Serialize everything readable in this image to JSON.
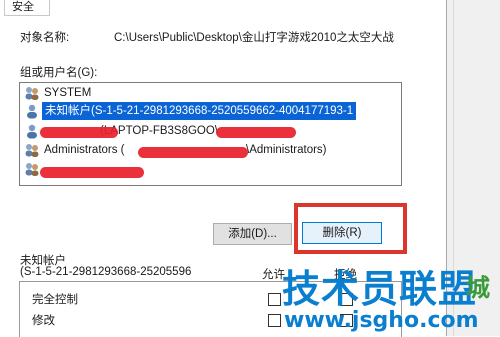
{
  "tab": {
    "label": "安全"
  },
  "object": {
    "label": "对象名称:",
    "value": "C:\\Users\\Public\\Desktop\\金山打字游戏2010之太空大战"
  },
  "groups": {
    "label": "组或用户名(G):",
    "items": [
      {
        "label": "SYSTEM",
        "selected": false
      },
      {
        "label": "未知帐户(S-1-5-21-2981293668-2520559662-4004177193-1",
        "selected": true
      },
      {
        "label": "(LAPTOP-FB3S8GOO\\",
        "selected": false
      },
      {
        "label": "Administrators (",
        "suffix": "\\Administrators)",
        "selected": false
      },
      {
        "label": "",
        "selected": false
      }
    ]
  },
  "buttons": {
    "add": "添加(D)...",
    "remove": "删除(R)"
  },
  "permissions": {
    "for_label": "未知帐户",
    "sid_label": "(S-1-5-21-2981293668-25205596",
    "allow": "允许",
    "deny": "拒绝",
    "rows": [
      {
        "label": "完全控制"
      },
      {
        "label": "修改"
      }
    ]
  },
  "watermark": {
    "title": "技术员联盟",
    "url": "www.jsgho.com",
    "side": "城"
  }
}
